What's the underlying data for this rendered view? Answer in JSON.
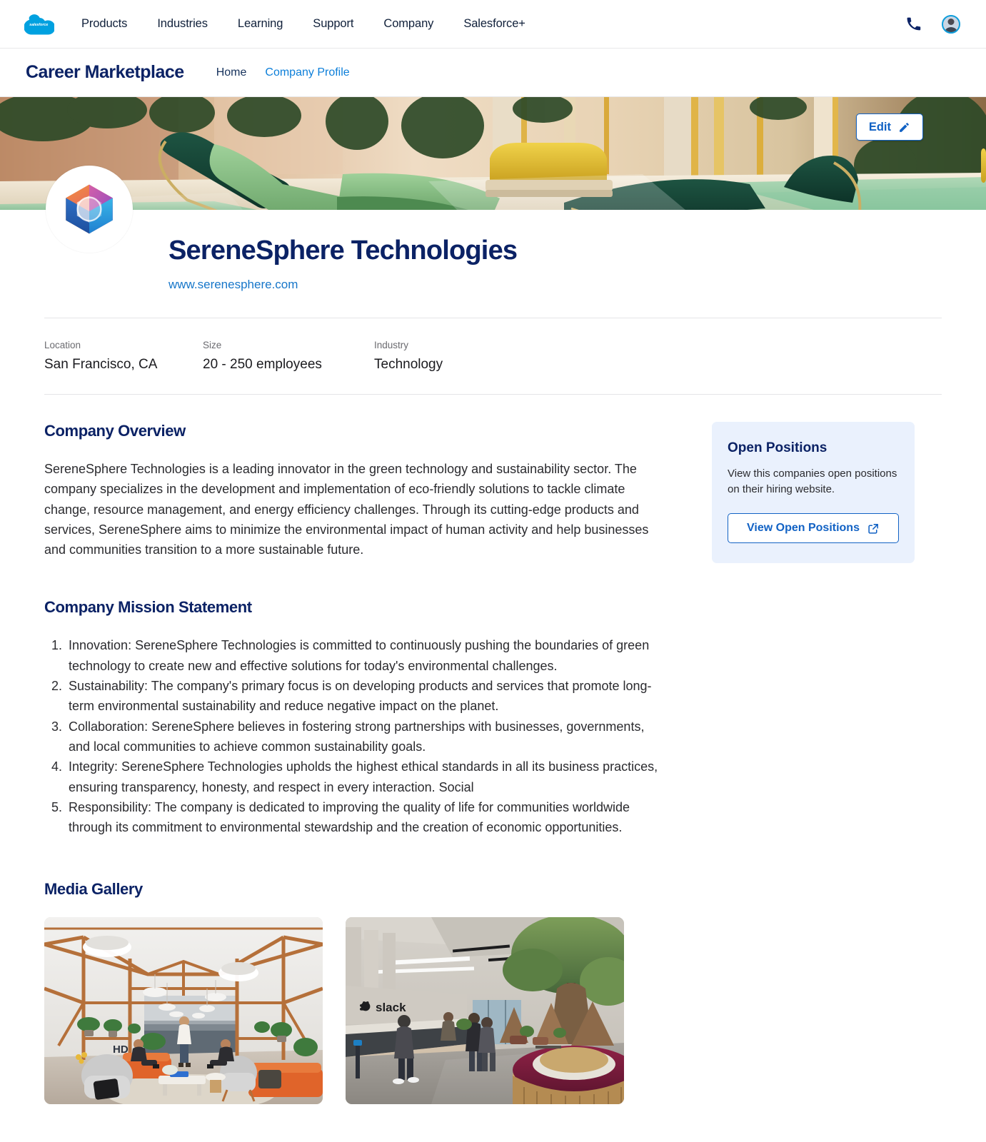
{
  "global_nav": {
    "logo_alt": "salesforce",
    "links": [
      {
        "label": "Products"
      },
      {
        "label": "Industries"
      },
      {
        "label": "Learning"
      },
      {
        "label": "Support"
      },
      {
        "label": "Company"
      },
      {
        "label": "Salesforce+"
      }
    ],
    "phone_icon": "phone-icon",
    "avatar_icon": "user-avatar"
  },
  "sub_nav": {
    "brand": "Career Marketplace",
    "links": [
      {
        "label": "Home",
        "active": false
      },
      {
        "label": "Company Profile",
        "active": true
      }
    ]
  },
  "hero": {
    "edit_label": "Edit",
    "edit_icon": "pencil-icon"
  },
  "company": {
    "name": "SereneSphere Technologies",
    "url": "www.serenesphere.com",
    "logo_icon": "hexagon-logo"
  },
  "meta": [
    {
      "label": "Location",
      "value": "San Francisco, CA"
    },
    {
      "label": "Size",
      "value": "20 - 250 employees"
    },
    {
      "label": "Industry",
      "value": "Technology"
    }
  ],
  "overview": {
    "title": "Company Overview",
    "body": "SereneSphere Technologies is a leading innovator in the green technology and sustainability sector. The company specializes in the development and implementation of eco-friendly solutions to tackle climate change, resource management, and energy efficiency challenges. Through its cutting-edge products and services, SereneSphere aims to minimize the environmental impact of human activity and help businesses and communities transition to a more sustainable future."
  },
  "mission": {
    "title": "Company Mission Statement",
    "items": [
      "Innovation: SereneSphere Technologies is committed to continuously pushing the boundaries of green technology to create new and effective solutions for today's environmental challenges.",
      "Sustainability: The company's primary focus is on developing products and services that promote long-term environmental sustainability and reduce negative impact on the planet.",
      "Collaboration: SereneSphere believes in fostering strong partnerships with businesses, governments, and local communities to achieve common sustainability goals.",
      "Integrity: SereneSphere Technologies upholds the highest ethical standards in all its business practices, ensuring transparency, honesty, and respect in every interaction. Social",
      "Responsibility: The company is dedicated to improving the quality of life for communities worldwide through its commitment to environmental stewardship and the creation of economic opportunities."
    ]
  },
  "open_positions": {
    "title": "Open Positions",
    "description": "View this companies open positions on their hiring website.",
    "button_label": "View Open Positions",
    "button_icon": "external-link-icon"
  },
  "gallery": {
    "title": "Media Gallery",
    "items": [
      {
        "caption": "office-lounge-photo"
      },
      {
        "caption": "slack-lobby-photo",
        "brand_text": "slack"
      }
    ]
  },
  "colors": {
    "brand_navy": "#0b2265",
    "link_blue": "#1676c9",
    "accent_blue": "#1262c4",
    "card_bg": "#eaf1fd",
    "salesforce_blue": "#00a1e0"
  }
}
